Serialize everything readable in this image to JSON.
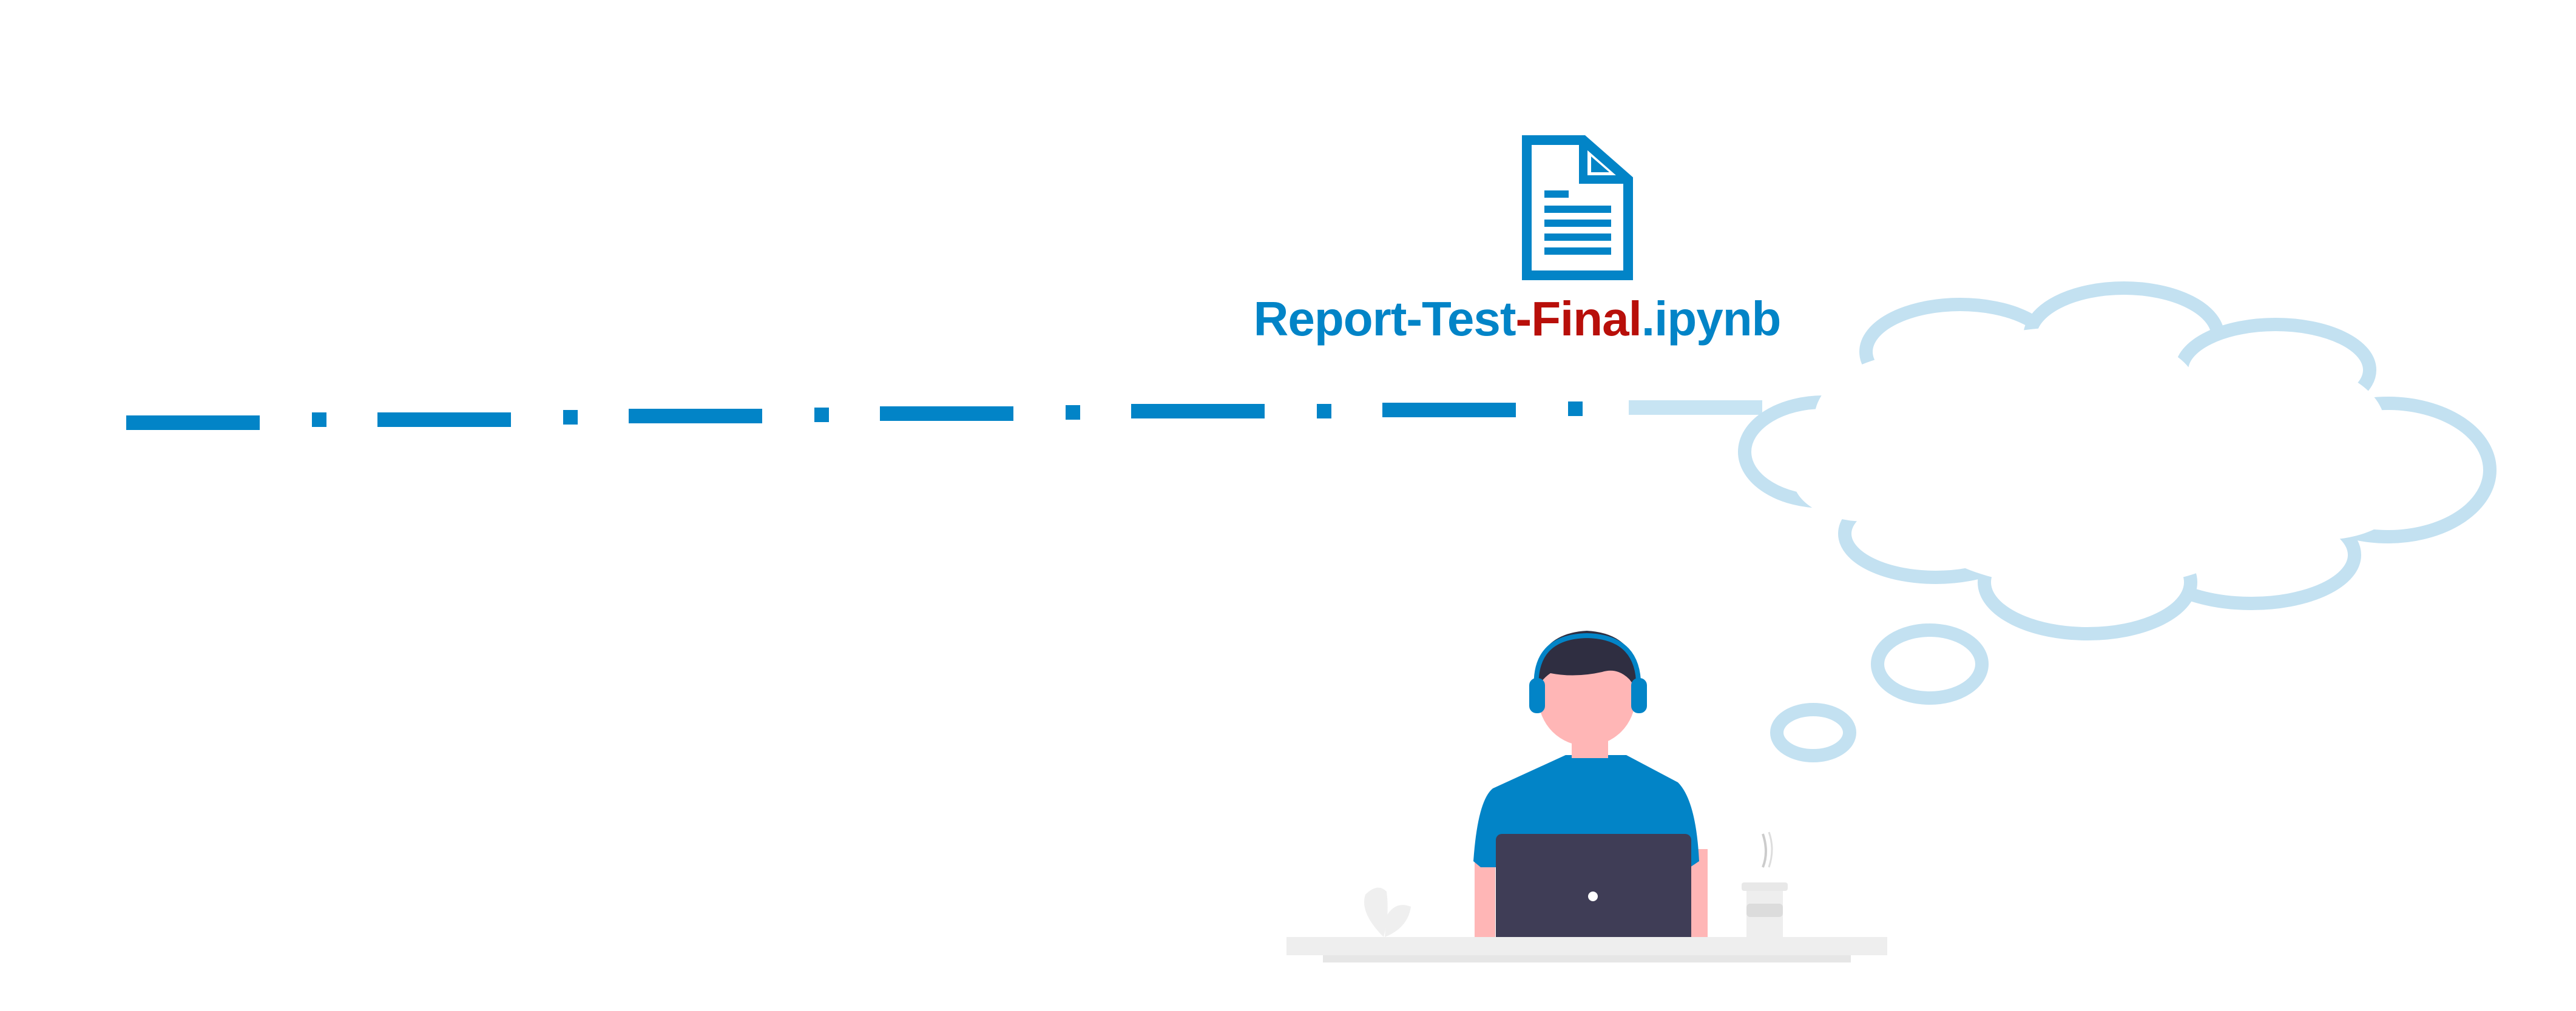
{
  "file": {
    "icon": "document-icon",
    "name_parts": [
      {
        "text": "Report-Test",
        "color": "#0284c7"
      },
      {
        "text": "-Final",
        "color": "#b80f0a"
      },
      {
        "text": ".ipynb",
        "color": "#0284c7"
      }
    ]
  },
  "colors": {
    "primary_blue": "#0284c7",
    "light_blue": "#c7e4f3",
    "red": "#b80f0a",
    "skin": "#ffb6b6",
    "hair": "#2f2e41",
    "laptop": "#3f3d56",
    "desk": "#f0f0f0"
  },
  "icons": [
    "document-icon",
    "thought-cloud-icon",
    "person-with-headphones-icon",
    "laptop-icon",
    "coffee-cup-icon",
    "plant-icon"
  ]
}
